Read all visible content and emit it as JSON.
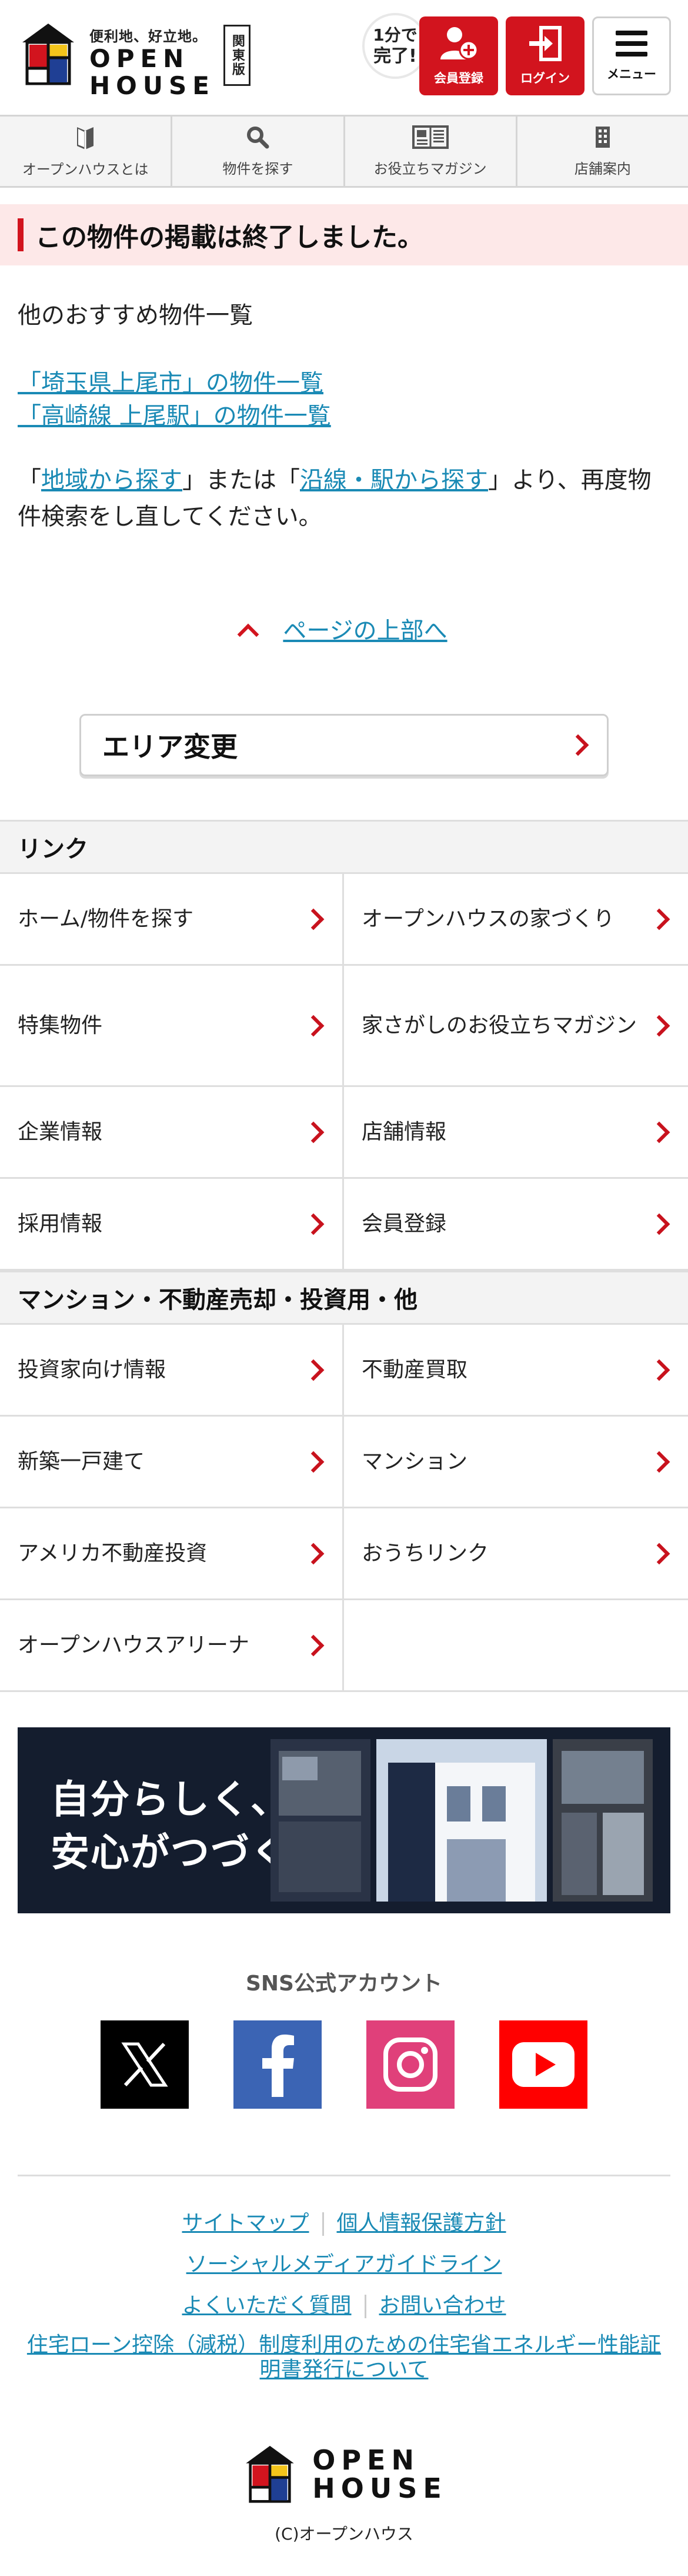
{
  "header": {
    "tagline": "便利地、好立地。",
    "logo_line1": "OPEN",
    "logo_line2": "HOUSE",
    "region": "関東版",
    "quick_line1": "1分",
    "quick_line1_suffix": "で",
    "quick_line2": "完了!",
    "register_label": "会員登録",
    "login_label": "ログイン",
    "menu_label": "メニュー"
  },
  "nav": [
    {
      "label": "オープンハウスとは"
    },
    {
      "label": "物件を探す"
    },
    {
      "label": "お役立ちマガジン"
    },
    {
      "label": "店舗案内"
    }
  ],
  "notice": "この物件の掲載は終了しました。",
  "recommend_heading": "他のおすすめ物件一覧",
  "links": [
    "「埼玉県上尾市」の物件一覧",
    "「高崎線 上尾駅」の物件一覧"
  ],
  "research": {
    "q1": "「",
    "link1": "地域から探す",
    "mid": "」または「",
    "link2": "沿線・駅から探す",
    "tail": "」より、再度物件検索をし直してください。"
  },
  "to_top": "ページの上部へ",
  "area_change": "エリア変更",
  "sections": [
    {
      "title": "リンク",
      "items": [
        "ホーム/物件を探す",
        "オープンハウスの家づくり",
        "特集物件",
        "家さがしのお役立ちマガジン",
        "企業情報",
        "店舗情報",
        "採用情報",
        "会員登録"
      ]
    },
    {
      "title": "マンション・不動産売却・投資用・他",
      "items": [
        "投資家向け情報",
        "不動産買取",
        "新築一戸建て",
        "マンション",
        "アメリカ不動産投資",
        "おうちリンク",
        "オープンハウスアリーナ"
      ]
    }
  ],
  "banner": {
    "line1": "自分らしく、",
    "line2": "安心がつづく家。"
  },
  "sns_title": "SNS公式アカウント",
  "footer": {
    "sitemap": "サイトマップ",
    "privacy": "個人情報保護方針",
    "social_guide": "ソーシャルメディアガイドライン",
    "faq": "よくいただく質問",
    "contact": "お問い合わせ",
    "loan": "住宅ローン控除（減税）制度利用のための住宅省エネルギー性能証明書発行について",
    "logo_line1": "OPEN",
    "logo_line2": "HOUSE",
    "copyright": "(C)オープンハウス"
  },
  "colors": {
    "brand_red": "#d2141e",
    "link_blue": "#1a8ab5",
    "notice_bg": "#fde8e8"
  },
  "icons": [
    "open-house-logo",
    "user-plus-icon",
    "login-door-icon",
    "hamburger-icon",
    "book-icon",
    "search-icon",
    "magazine-icon",
    "building-icon",
    "chevron-up-icon",
    "chevron-right-icon",
    "x-icon",
    "facebook-icon",
    "instagram-icon",
    "youtube-icon"
  ]
}
